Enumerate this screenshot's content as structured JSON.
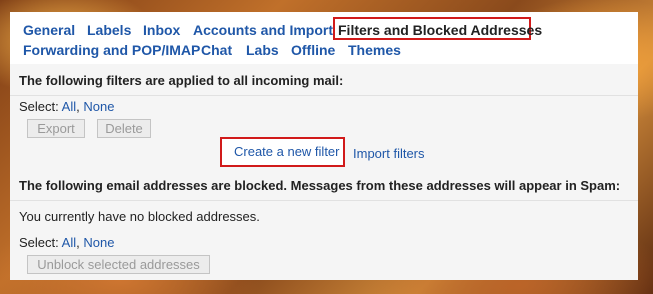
{
  "tabs": {
    "general": "General",
    "labels": "Labels",
    "inbox": "Inbox",
    "accounts": "Accounts and Import",
    "filters": "Filters and Blocked Addresses",
    "forwarding": "Forwarding and POP/IMAP",
    "chat": "Chat",
    "labs": "Labs",
    "offline": "Offline",
    "themes": "Themes"
  },
  "filters": {
    "heading": "The following filters are applied to all incoming mail:",
    "select_label": "Select:",
    "select_all": "All",
    "select_separator": ",",
    "select_none": "None",
    "export_label": "Export",
    "delete_label": "Delete",
    "create_label": "Create a new filter",
    "import_label": "Import filters"
  },
  "blocked": {
    "heading": "The following email addresses are blocked. Messages from these addresses will appear in Spam:",
    "empty_message": "You currently have no blocked addresses.",
    "select_label": "Select:",
    "select_all": "All",
    "select_separator": ",",
    "select_none": "None",
    "unblock_label": "Unblock selected addresses"
  },
  "colors": {
    "link": "#1f57a8",
    "highlight_border": "#d11a1a",
    "panel_bg": "#f5f5f5"
  }
}
